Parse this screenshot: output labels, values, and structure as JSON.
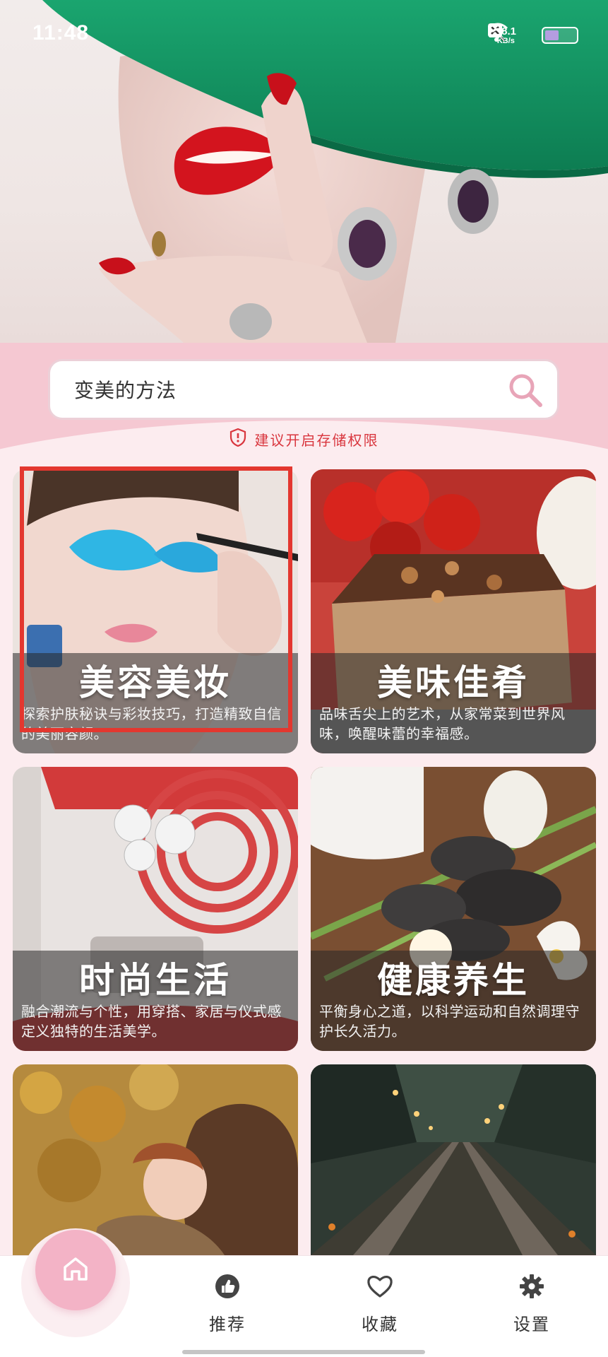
{
  "status_bar": {
    "time": "11:48",
    "speed_value": "88.1",
    "speed_unit": "KB/s",
    "icons": [
      "mute-bell-icon",
      "close-box-icon",
      "wifi-icon",
      "battery-icon"
    ],
    "battery_level": 0.45
  },
  "hero": {
    "image": "woman-green-hat-red-lips-ring"
  },
  "search": {
    "text": "变美的方法",
    "icon": "search-icon",
    "accent_color": "#e8a5b8"
  },
  "permission_tip": {
    "icon": "shield-icon",
    "text": "建议开启存储权限",
    "color": "#d9363e"
  },
  "cards": [
    {
      "title": "美容美妆",
      "desc": "探索护肤秘诀与彩妆技巧，打造精致自信的美丽容颜。",
      "image": "woman-blue-eyeshadow-makeup"
    },
    {
      "title": "美味佳肴",
      "desc": "品味舌尖上的艺术，从家常菜到世界风味，唤醒味蕾的幸福感。",
      "image": "cake-strawberries"
    },
    {
      "title": "时尚生活",
      "desc": "融合潮流与个性，用穿搭、家居与仪式感定义独特的生活美学。",
      "image": "modern-red-interior"
    },
    {
      "title": "健康养生",
      "desc": "平衡身心之道，以科学运动和自然调理守护长久活力。",
      "image": "spa-stones-bamboo"
    },
    {
      "title": "",
      "desc": "",
      "image": "mother-child-autumn-leaves"
    },
    {
      "title": "",
      "desc": "",
      "image": "railway-tracks-lights"
    }
  ],
  "bottom_nav": {
    "home_icon": "home-icon",
    "items": [
      {
        "label": "推荐",
        "icon": "thumbs-up-icon"
      },
      {
        "label": "收藏",
        "icon": "heart-icon"
      },
      {
        "label": "设置",
        "icon": "gear-icon"
      }
    ]
  },
  "colors": {
    "page_bg": "#fcecef",
    "search_band": "#f5c8d2",
    "home_button": "#f3b3c6",
    "selection_frame": "#e3372f"
  }
}
